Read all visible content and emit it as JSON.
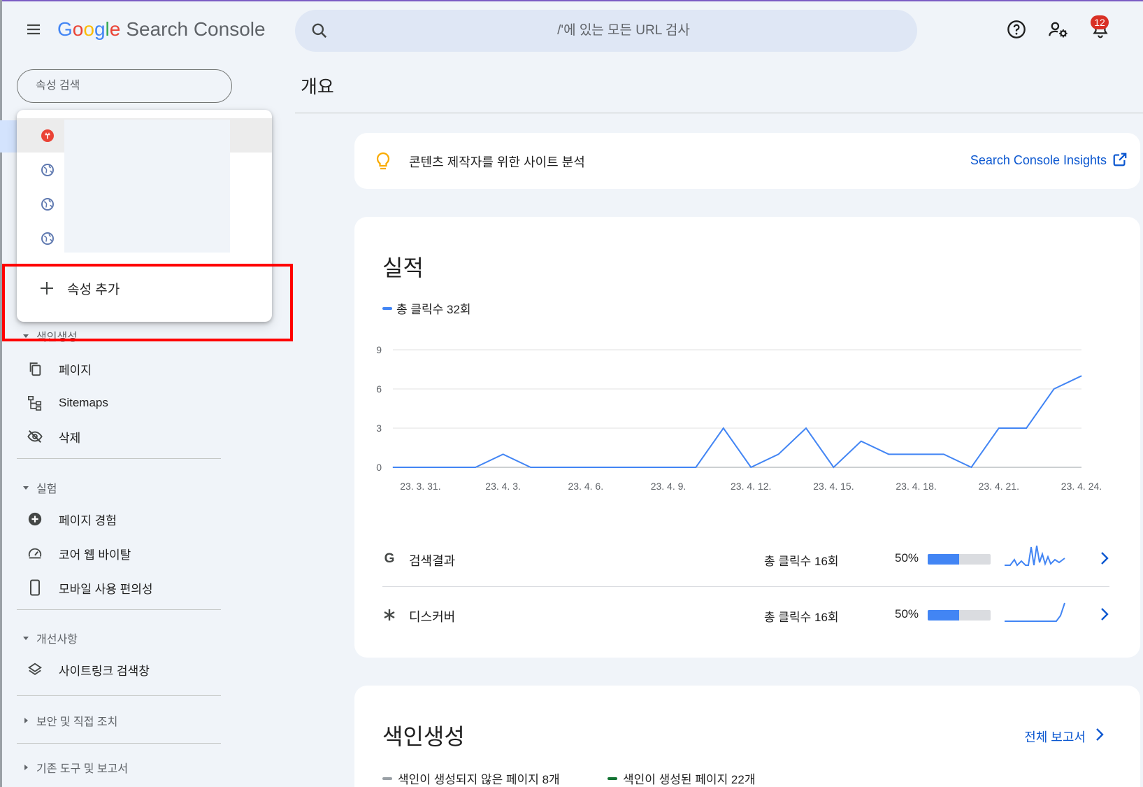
{
  "header": {
    "logo_google": [
      "G",
      "o",
      "o",
      "g",
      "l",
      "e"
    ],
    "logo_product": "Search Console",
    "search_placeholder": "/'에 있는 모든 URL 검사",
    "notification_count": "12"
  },
  "sidebar": {
    "property_search_placeholder": "속성 검색",
    "sections": [
      {
        "label": "색인생성",
        "expanded": true,
        "items": [
          "페이지",
          "Sitemaps",
          "삭제"
        ]
      },
      {
        "label": "실험",
        "expanded": true,
        "items": [
          "페이지 경험",
          "코어 웹 바이탈",
          "모바일 사용 편의성"
        ]
      },
      {
        "label": "개선사항",
        "expanded": true,
        "items": [
          "사이트링크 검색창"
        ]
      },
      {
        "label": "보안 및 직접 조치",
        "expanded": false,
        "items": []
      },
      {
        "label": "기존 도구 및 보고서",
        "expanded": false,
        "items": []
      }
    ]
  },
  "property_dropdown": {
    "add_property_label": "속성 추가"
  },
  "main": {
    "page_title": "개요",
    "insight": {
      "text": "콘텐츠 제작자를 위한 사이트 분석",
      "link": "Search Console Insights"
    },
    "performance": {
      "title": "실적",
      "legend": "총 클릭수 32회",
      "rows": [
        {
          "label": "검색결과",
          "clicks": "총 클릭수 16회",
          "percent": "50%",
          "share": 0.5
        },
        {
          "label": "디스커버",
          "clicks": "총 클릭수 16회",
          "percent": "50%",
          "share": 0.5
        }
      ]
    },
    "indexing": {
      "title": "색인생성",
      "link": "전체 보고서",
      "legend_not_indexed": "색인이 생성되지 않은 페이지 8개",
      "legend_indexed": "색인이 생성된 페이지 22개"
    }
  },
  "colors": {
    "accent_blue": "#4285f4",
    "link_blue": "#0b57d0",
    "highlight_red": "#ff0000",
    "not_indexed_gray": "#9aa0a6",
    "indexed_green": "#137333"
  },
  "chart_data": {
    "type": "line",
    "series": [
      {
        "name": "총 클릭수 32회",
        "values": [
          0,
          0,
          0,
          0,
          1,
          0,
          0,
          0,
          0,
          0,
          0,
          0,
          3,
          0,
          1,
          3,
          0,
          2,
          1,
          1,
          1,
          0,
          3,
          3,
          6,
          7
        ]
      }
    ],
    "x": [
      "23. 3. 30.",
      "23. 3. 31.",
      "23. 4. 1.",
      "23. 4. 2.",
      "23. 4. 3.",
      "23. 4. 4.",
      "23. 4. 5.",
      "23. 4. 6.",
      "23. 4. 7.",
      "23. 4. 8.",
      "23. 4. 9.",
      "23. 4. 10.",
      "23. 4. 11.",
      "23. 4. 12.",
      "23. 4. 13.",
      "23. 4. 14.",
      "23. 4. 15.",
      "23. 4. 16.",
      "23. 4. 17.",
      "23. 4. 18.",
      "23. 4. 19.",
      "23. 4. 20.",
      "23. 4. 21.",
      "23. 4. 22.",
      "23. 4. 23.",
      "23. 4. 24."
    ],
    "xtick_labels": [
      "23. 3. 31.",
      "23. 4. 3.",
      "23. 4. 6.",
      "23. 4. 9.",
      "23. 4. 12.",
      "23. 4. 15.",
      "23. 4. 18.",
      "23. 4. 21.",
      "23. 4. 24."
    ],
    "xtick_index": [
      1,
      4,
      7,
      10,
      13,
      16,
      19,
      22,
      25
    ],
    "yticks": [
      0,
      3,
      6,
      9
    ],
    "ylim": [
      0,
      9
    ],
    "grid": true
  }
}
